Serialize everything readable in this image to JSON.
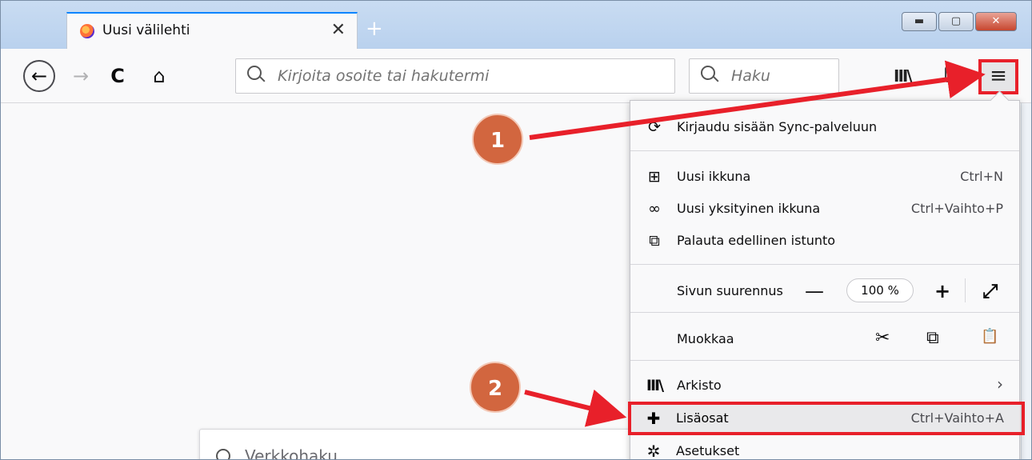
{
  "tab": {
    "title": "Uusi välilehti",
    "close_glyph": "✕",
    "new_tab_glyph": "+"
  },
  "window_controls": {
    "minimize": "▬",
    "maximize": "▢",
    "close": "✕"
  },
  "toolbar": {
    "back_glyph": "←",
    "forward_glyph": "→",
    "reload_glyph": "C",
    "home_glyph": "⌂",
    "url_placeholder": "Kirjoita osoite tai hakutermi",
    "search_placeholder": "Haku",
    "library_glyph": "III\\",
    "menu_glyph": "≡"
  },
  "newtab_search": {
    "placeholder": "Verkkohaku"
  },
  "menu": {
    "sync": {
      "label": "Kirjaudu sisään Sync-palveluun",
      "icon": "sync-icon"
    },
    "new_window": {
      "label": "Uusi ikkuna",
      "shortcut": "Ctrl+N",
      "icon": "new-window-icon"
    },
    "private_window": {
      "label": "Uusi yksityinen ikkuna",
      "shortcut": "Ctrl+Vaihto+P",
      "icon": "private-mask-icon"
    },
    "restore": {
      "label": "Palauta edellinen istunto",
      "icon": "restore-session-icon"
    },
    "zoom": {
      "label": "Sivun suurennus",
      "minus": "—",
      "value": "100 %",
      "plus": "+",
      "fullscreen": "⤢"
    },
    "edit": {
      "label": "Muokkaa",
      "cut": "✂",
      "copy": "⧉",
      "paste": "📋"
    },
    "library": {
      "label": "Arkisto",
      "chevron": "›",
      "icon": "library-icon"
    },
    "addons": {
      "label": "Lisäosat",
      "shortcut": "Ctrl+Vaihto+A",
      "icon": "puzzle-icon"
    },
    "settings": {
      "label": "Asetukset",
      "icon": "gear-icon"
    }
  },
  "annotations": {
    "step1": "1",
    "step2": "2",
    "color": "#e8202a",
    "badge_color": "#d2663f"
  }
}
